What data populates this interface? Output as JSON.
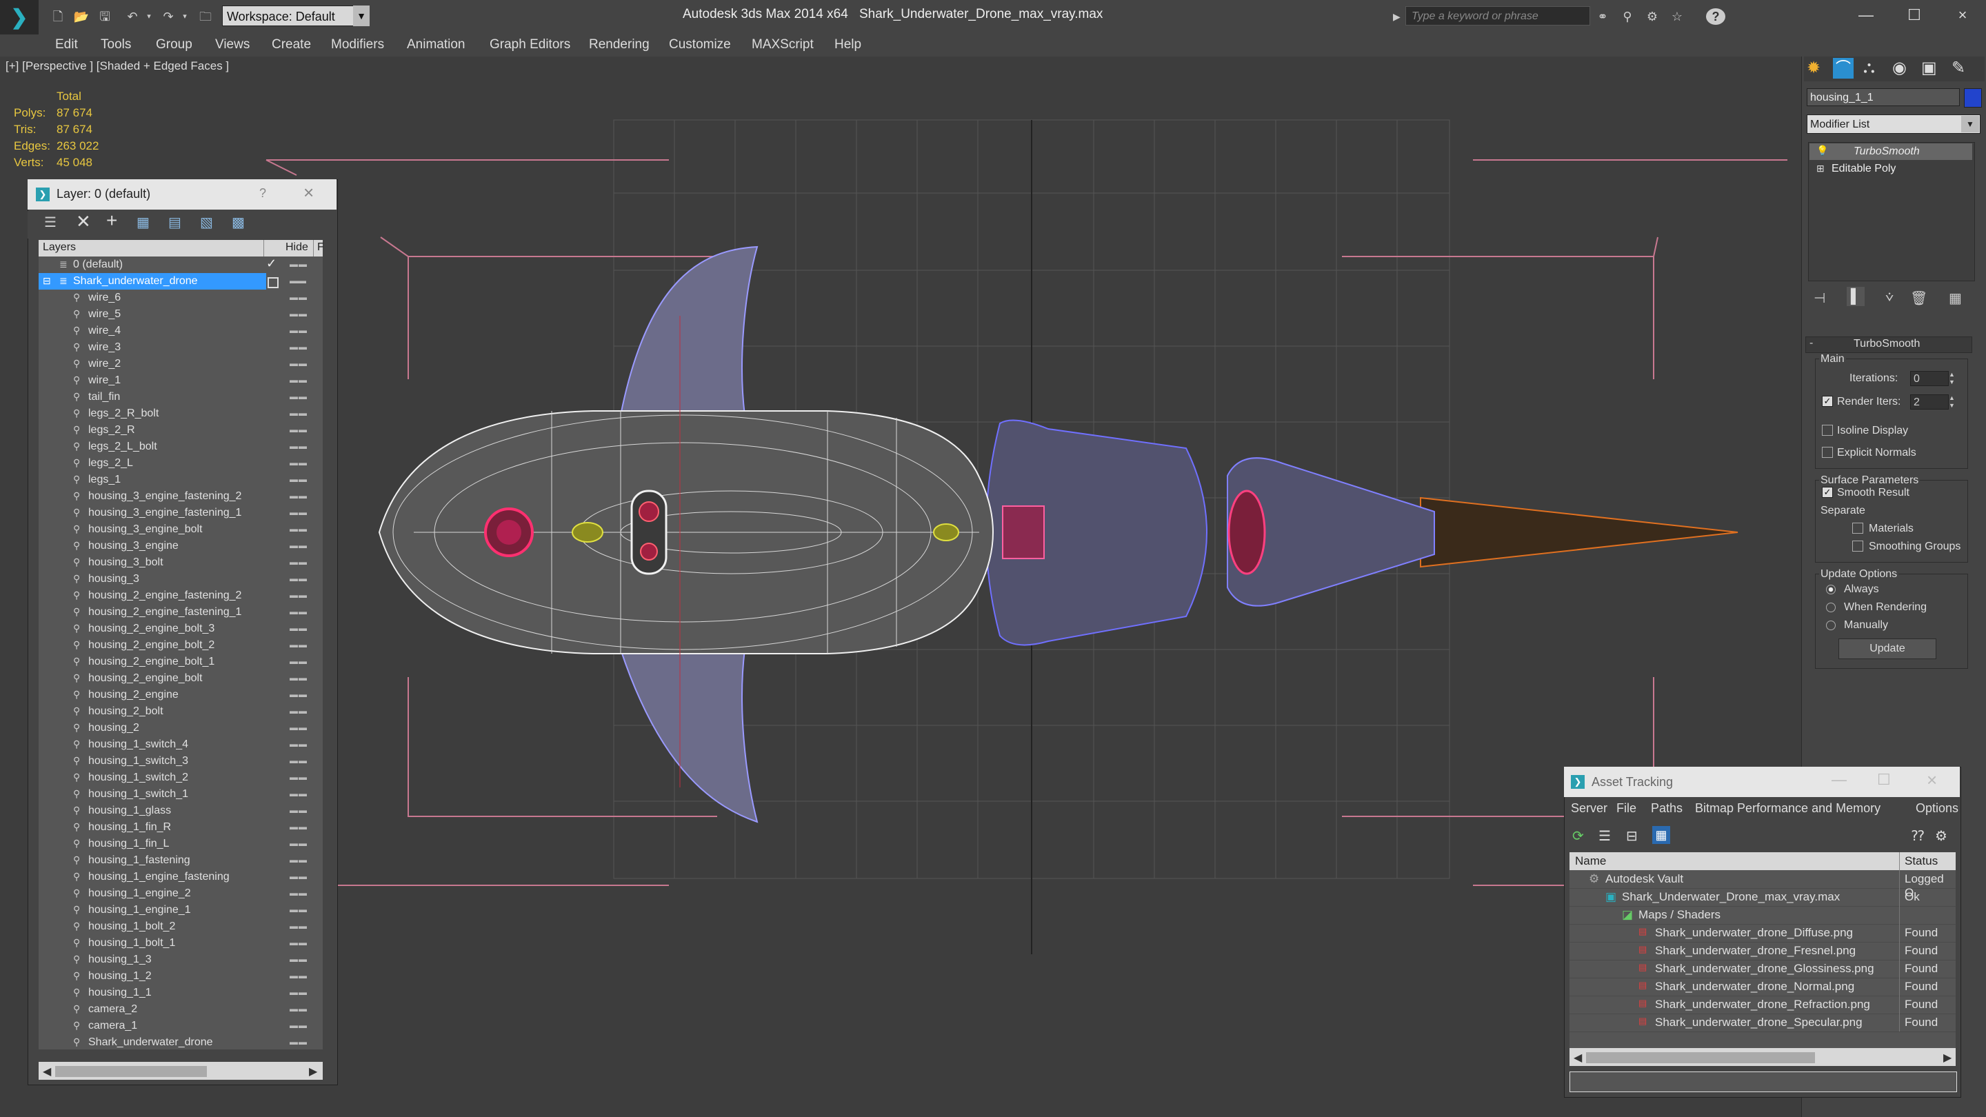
{
  "window": {
    "app_title": "Autodesk 3ds Max 2014 x64",
    "file_title": "Shark_Underwater_Drone_max_vray.max",
    "workspace": "Workspace: Default",
    "search_placeholder": "Type a keyword or phrase"
  },
  "menu": [
    "Edit",
    "Tools",
    "Group",
    "Views",
    "Create",
    "Modifiers",
    "Animation",
    "Graph Editors",
    "Rendering",
    "Customize",
    "MAXScript",
    "Help"
  ],
  "viewport": {
    "label": "[+] [Perspective ] [Shaded + Edged Faces ]",
    "stats": {
      "header": "Total",
      "polys_label": "Polys:",
      "polys": "87 674",
      "tris_label": "Tris:",
      "tris": "87 674",
      "edges_label": "Edges:",
      "edges": "263 022",
      "verts_label": "Verts:",
      "verts": "45 048"
    }
  },
  "layer_window": {
    "title": "Layer: 0 (default)",
    "help": "?",
    "col_layers": "Layers",
    "col_hide": "Hide",
    "col_freeze": "F",
    "layers": [
      "0 (default)",
      "Shark_underwater_drone"
    ],
    "objects": [
      "wire_6",
      "wire_5",
      "wire_4",
      "wire_3",
      "wire_2",
      "wire_1",
      "tail_fin",
      "legs_2_R_bolt",
      "legs_2_R",
      "legs_2_L_bolt",
      "legs_2_L",
      "legs_1",
      "housing_3_engine_fastening_2",
      "housing_3_engine_fastening_1",
      "housing_3_engine_bolt",
      "housing_3_engine",
      "housing_3_bolt",
      "housing_3",
      "housing_2_engine_fastening_2",
      "housing_2_engine_fastening_1",
      "housing_2_engine_bolt_3",
      "housing_2_engine_bolt_2",
      "housing_2_engine_bolt_1",
      "housing_2_engine_bolt",
      "housing_2_engine",
      "housing_2_bolt",
      "housing_2",
      "housing_1_switch_4",
      "housing_1_switch_3",
      "housing_1_switch_2",
      "housing_1_switch_1",
      "housing_1_glass",
      "housing_1_fin_R",
      "housing_1_fin_L",
      "housing_1_fastening",
      "housing_1_engine_fastening",
      "housing_1_engine_2",
      "housing_1_engine_1",
      "housing_1_bolt_2",
      "housing_1_bolt_1",
      "housing_1_3",
      "housing_1_2",
      "housing_1_1",
      "camera_2",
      "camera_1",
      "Shark_underwater_drone"
    ]
  },
  "command_panel": {
    "object_name": "housing_1_1",
    "object_color": "#2244cc",
    "modifier_list": "Modifier List",
    "stack": [
      "TurboSmooth",
      "Editable Poly"
    ],
    "rollout_title": "TurboSmooth",
    "main_label": "Main",
    "iterations_label": "Iterations:",
    "iterations": "0",
    "render_iters_label": "Render Iters:",
    "render_iters": "2",
    "render_iters_checked": true,
    "isoline_label": "Isoline Display",
    "explicit_normals_label": "Explicit Normals",
    "surface_label": "Surface Parameters",
    "smooth_result_label": "Smooth Result",
    "separate_label": "Separate",
    "materials_label": "Materials",
    "smoothing_groups_label": "Smoothing Groups",
    "update_options_label": "Update Options",
    "always_label": "Always",
    "when_rendering_label": "When Rendering",
    "manually_label": "Manually",
    "update_button": "Update"
  },
  "asset_tracking": {
    "title": "Asset Tracking",
    "menu": [
      "Server",
      "File",
      "Paths",
      "Bitmap Performance and Memory",
      "Options"
    ],
    "col_name": "Name",
    "col_status": "Status",
    "rows": [
      {
        "name": "Autodesk Vault",
        "status": "Logged O"
      },
      {
        "name": "Shark_Underwater_Drone_max_vray.max",
        "status": "Ok"
      },
      {
        "name": "Maps / Shaders",
        "status": ""
      },
      {
        "name": "Shark_underwater_drone_Diffuse.png",
        "status": "Found"
      },
      {
        "name": "Shark_underwater_drone_Fresnel.png",
        "status": "Found"
      },
      {
        "name": "Shark_underwater_drone_Glossiness.png",
        "status": "Found"
      },
      {
        "name": "Shark_underwater_drone_Normal.png",
        "status": "Found"
      },
      {
        "name": "Shark_underwater_drone_Refraction.png",
        "status": "Found"
      },
      {
        "name": "Shark_underwater_drone_Specular.png",
        "status": "Found"
      }
    ]
  },
  "icons": {
    "close": "×",
    "minimize": "—",
    "maximize": "☐",
    "check": "✓"
  }
}
